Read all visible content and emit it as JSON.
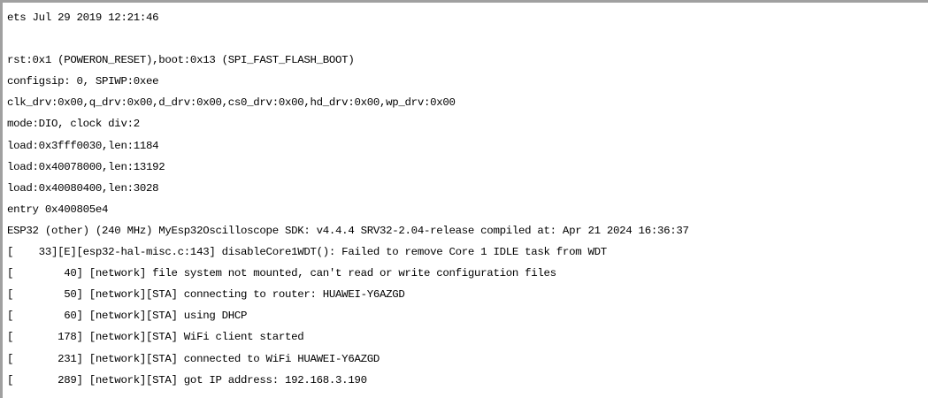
{
  "terminal": {
    "lines": [
      "ets Jul 29 2019 12:21:46",
      "",
      "rst:0x1 (POWERON_RESET),boot:0x13 (SPI_FAST_FLASH_BOOT)",
      "configsip: 0, SPIWP:0xee",
      "clk_drv:0x00,q_drv:0x00,d_drv:0x00,cs0_drv:0x00,hd_drv:0x00,wp_drv:0x00",
      "mode:DIO, clock div:2",
      "load:0x3fff0030,len:1184",
      "load:0x40078000,len:13192",
      "load:0x40080400,len:3028",
      "entry 0x400805e4",
      "ESP32 (other) (240 MHz) MyEsp32Oscilloscope SDK: v4.4.4 SRV32-2.04-release compiled at: Apr 21 2024 16:36:37",
      "[    33][E][esp32-hal-misc.c:143] disableCore1WDT(): Failed to remove Core 1 IDLE task from WDT",
      "[        40] [network] file system not mounted, can't read or write configuration files",
      "[        50] [network][STA] connecting to router: HUAWEI-Y6AZGD",
      "[        60] [network][STA] using DHCP",
      "[       178] [network][STA] WiFi client started",
      "[       231] [network][STA] connected to WiFi HUAWEI-Y6AZGD",
      "[       289] [network][STA] got IP address: 192.168.3.190"
    ]
  }
}
